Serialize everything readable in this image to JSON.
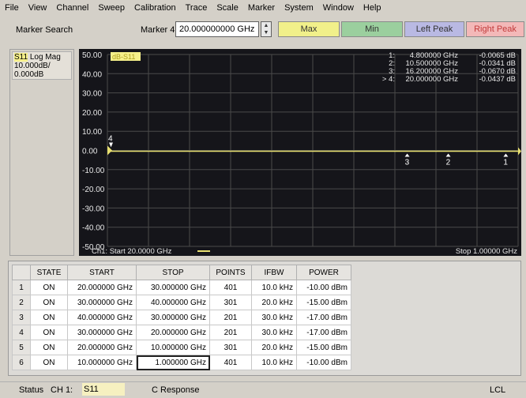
{
  "menu": [
    "File",
    "View",
    "Channel",
    "Sweep",
    "Calibration",
    "Trace",
    "Scale",
    "Marker",
    "System",
    "Window",
    "Help"
  ],
  "toolbar": {
    "title": "Marker Search",
    "marker_label": "Marker 4",
    "marker_value": "20.000000000 GHz",
    "max_label": "Max",
    "min_label": "Min",
    "left_peak_label": "Left Peak",
    "right_peak_label": "Right Peak",
    "colors": {
      "max": "#f1f08a",
      "min": "#9bcf9e",
      "left_peak": "#b9b9e3",
      "right_peak": "#f3b8b8"
    }
  },
  "channel_info": {
    "trace": "S11",
    "format": "Log Mag",
    "scale": "10.000dB/",
    "ref": "0.000dB"
  },
  "plot": {
    "trace_tag": "dB-S11",
    "y_ticks": [
      "50.00",
      "40.00",
      "30.00",
      "20.00",
      "10.00",
      "0.00",
      "-10.00",
      "-20.00",
      "-30.00",
      "-40.00",
      "-50.00"
    ],
    "y_values": [
      50,
      40,
      30,
      20,
      10,
      0,
      -10,
      -20,
      -30,
      -40,
      -50
    ],
    "y_range": [
      -50,
      50
    ],
    "x_range_ghz": [
      0.02,
      1.0
    ],
    "start_label": "Ch1: Start  20.0000 GHz",
    "stop_label": "Stop  1.00000 GHz",
    "marker_table": [
      {
        "id": "1:",
        "freq": "4.800000 GHz",
        "value": "-0.0065 dB"
      },
      {
        "id": "2:",
        "freq": "10.500000 GHz",
        "value": "-0.0341 dB"
      },
      {
        "id": "3:",
        "freq": "16.200000 GHz",
        "value": "-0.0670 dB"
      },
      {
        "id": "> 4:",
        "freq": "20.000000 GHz",
        "value": "-0.0437 dB"
      }
    ],
    "marker_flags": [
      {
        "label": "4",
        "x_frac": 0.0
      },
      {
        "label": "3",
        "x_frac": 0.73
      },
      {
        "label": "2",
        "x_frac": 0.83
      },
      {
        "label": "1",
        "x_frac": 0.97
      }
    ],
    "colors": {
      "background": "#15151a",
      "grid": "#4a4a4a",
      "trace": "#e8e070",
      "text": "#e8e8e8"
    }
  },
  "table": {
    "headers": [
      "",
      "STATE",
      "START",
      "STOP",
      "POINTS",
      "IFBW",
      "POWER"
    ],
    "rows": [
      [
        "1",
        "ON",
        "20.000000 GHz",
        "30.000000 GHz",
        "401",
        "10.0 kHz",
        "-10.00 dBm"
      ],
      [
        "2",
        "ON",
        "30.000000 GHz",
        "40.000000 GHz",
        "301",
        "20.0 kHz",
        "-15.00 dBm"
      ],
      [
        "3",
        "ON",
        "40.000000 GHz",
        "30.000000 GHz",
        "201",
        "30.0 kHz",
        "-17.00 dBm"
      ],
      [
        "4",
        "ON",
        "30.000000 GHz",
        "20.000000 GHz",
        "201",
        "30.0 kHz",
        "-17.00 dBm"
      ],
      [
        "5",
        "ON",
        "20.000000 GHz",
        "10.000000 GHz",
        "301",
        "20.0 kHz",
        "-15.00 dBm"
      ],
      [
        "6",
        "ON",
        "10.000000 GHz",
        "1.000000 GHz",
        "401",
        "10.0 kHz",
        "-10.00 dBm"
      ]
    ],
    "selected": {
      "row": 5,
      "col": 3
    }
  },
  "status": {
    "label": "Status",
    "channel": "CH 1:",
    "trace": "S11",
    "response": "C  Response",
    "lcl": "LCL"
  }
}
